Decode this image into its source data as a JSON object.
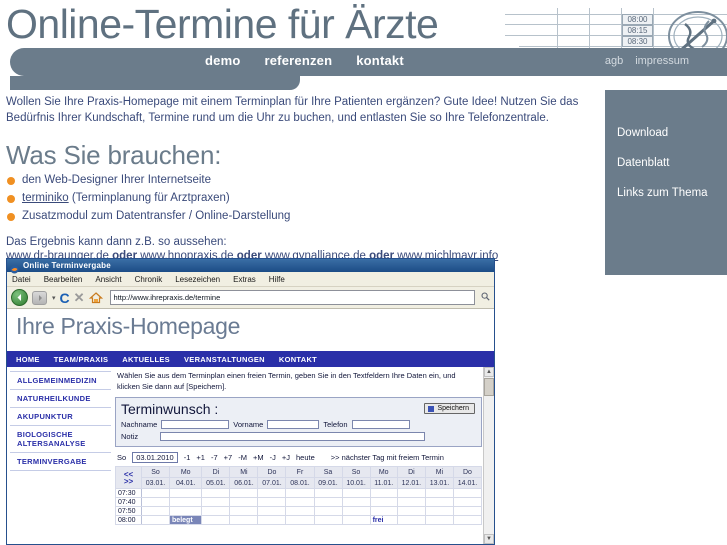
{
  "site": {
    "title": "Online-Termine für Ärzte",
    "nav": [
      {
        "label": "demo"
      },
      {
        "label": "referenzen"
      },
      {
        "label": "kontakt"
      }
    ],
    "nav_right": [
      {
        "label": "agb"
      },
      {
        "label": "impressum"
      }
    ],
    "decoration": {
      "time_1": "08:00",
      "time_2": "08:15",
      "time_3": "08:30"
    },
    "accent_color": "#6b7c8b",
    "bullet_color": "#f09022",
    "link_color": "#3a4a7a"
  },
  "sidebar": {
    "items": [
      {
        "label": "Download"
      },
      {
        "label": "Datenblatt"
      },
      {
        "label": "Links zum Thema"
      }
    ]
  },
  "main": {
    "intro": "Wollen Sie Ihre Praxis-Homepage mit einem Terminplan für Ihre Patienten ergänzen? Gute Idee! Nutzen Sie das Bedürfnis Ihrer Kundschaft, Termine rund um die Uhr zu buchen, und entlasten Sie so Ihre Telefonzentrale.",
    "heading": "Was Sie brauchen:",
    "needs": [
      {
        "text": "den Web-Designer Ihrer Internetseite",
        "link": ""
      },
      {
        "link": "terminiko",
        "text": " (Terminplanung für Arztpraxen)"
      },
      {
        "text": "Zusatzmodul zum Datentransfer / Online-Darstellung",
        "link": ""
      }
    ],
    "result_label": "Das Ergebnis kann dann z.B. so aussehen:",
    "result_links": [
      {
        "url": "www.dr-braunger.de"
      },
      {
        "url": "www.hnopraxis.de"
      },
      {
        "url": "www.gynalliance.de"
      },
      {
        "url": "www.michlmayr.info"
      }
    ],
    "result_separator": "oder"
  },
  "browser": {
    "window_title": "Online Terminvergabe",
    "menu": [
      {
        "label": "Datei"
      },
      {
        "label": "Bearbeiten"
      },
      {
        "label": "Ansicht"
      },
      {
        "label": "Chronik"
      },
      {
        "label": "Lesezeichen"
      },
      {
        "label": "Extras"
      },
      {
        "label": "Hilfe"
      }
    ],
    "toolbar": {
      "back": "◀",
      "forward": "▶",
      "dropdown": "▾",
      "reload": "C",
      "stop": "✕",
      "home": "⌂",
      "search": "🔍"
    },
    "url": "http://www.ihrepraxis.de/termine"
  },
  "innerpage": {
    "title": "Ihre Praxis-Homepage",
    "nav": [
      {
        "label": "HOME"
      },
      {
        "label": "TEAM/PRAXIS"
      },
      {
        "label": "AKTUELLES"
      },
      {
        "label": "VERANSTALTUNGEN"
      },
      {
        "label": "KONTAKT"
      }
    ],
    "sidebar": [
      {
        "label": "ALLGEMEINMEDIZIN"
      },
      {
        "label": "NATURHEILKUNDE"
      },
      {
        "label": "AKUPUNKTUR"
      },
      {
        "label": "BIOLOGISCHE ALTERSANALYSE"
      },
      {
        "label": "TERMINVERGABE"
      }
    ],
    "instruction": "Wählen Sie aus dem Terminplan einen freien Termin, geben Sie in den Textfeldern Ihre Daten ein, und klicken Sie dann auf [Speichern].",
    "form": {
      "title": "Terminwunsch :",
      "save_label": "Speichern",
      "fields": [
        {
          "label": "Nachname",
          "value": ""
        },
        {
          "label": "Vorname",
          "value": ""
        },
        {
          "label": "Telefon",
          "value": ""
        }
      ],
      "note_label": "Notiz",
      "note_value": ""
    },
    "datenav": {
      "weekday": "So",
      "date": "03.01.2010",
      "steps": [
        "-1",
        "+1",
        "-7",
        "+7",
        "-M",
        "+M",
        "-J",
        "+J"
      ],
      "today": "heute",
      "next_free": ">> nächster Tag mit freiem Termin"
    },
    "calendar": {
      "arrow_prev": "<<",
      "arrow_next": ">>",
      "weekdays": [
        "So",
        "Mo",
        "Di",
        "Mi",
        "Do",
        "Fr",
        "Sa",
        "So",
        "Mo",
        "Di",
        "Mi",
        "Do"
      ],
      "dates": [
        "03.01.",
        "04.01.",
        "05.01.",
        "06.01.",
        "07.01.",
        "08.01.",
        "09.01.",
        "10.01.",
        "11.01.",
        "12.01.",
        "13.01.",
        "14.01."
      ],
      "rows": [
        {
          "time": "07:30",
          "slots": [
            "",
            "",
            "",
            "",
            "",
            "",
            "",
            "",
            "",
            "",
            "",
            ""
          ]
        },
        {
          "time": "07:40",
          "slots": [
            "",
            "",
            "",
            "",
            "",
            "",
            "",
            "",
            "",
            "",
            "",
            ""
          ]
        },
        {
          "time": "07:50",
          "slots": [
            "",
            "",
            "",
            "",
            "",
            "",
            "",
            "",
            "",
            "",
            "",
            ""
          ]
        },
        {
          "time": "08:00",
          "slots": [
            "",
            "belegt",
            "",
            "",
            "",
            "",
            "",
            "",
            "frei",
            "",
            "",
            ""
          ]
        }
      ],
      "status_belegt": "belegt",
      "status_frei": "frei"
    }
  }
}
